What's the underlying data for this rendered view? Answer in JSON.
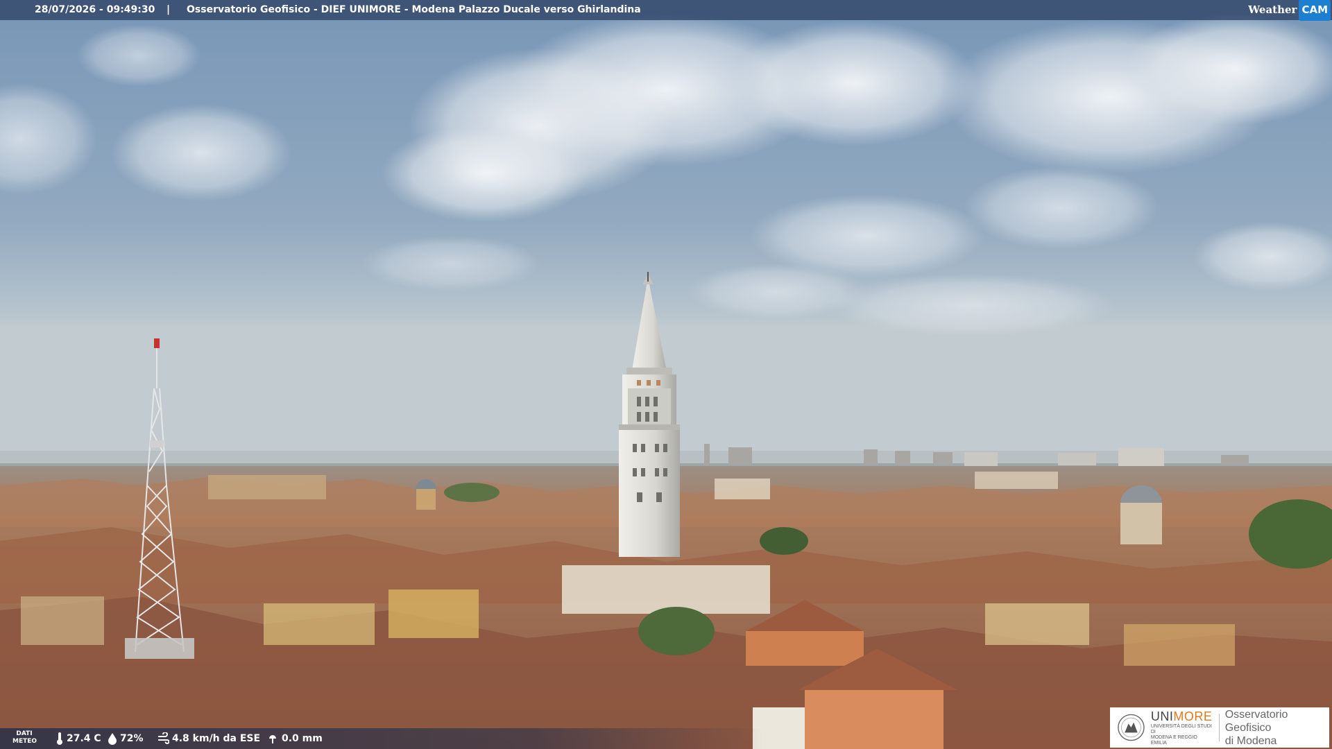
{
  "overlay": {
    "timestamp": "28/07/2026 - 09:49:30",
    "separator": "|",
    "location": "Osservatorio Geofisico - DIEF UNIMORE - Modena Palazzo Ducale verso Ghirlandina",
    "brand_weather": "Weather",
    "brand_cam": "CAM"
  },
  "weather": {
    "label_line1": "DATI",
    "label_line2": "METEO",
    "temperature": "27.4 C",
    "humidity": "72%",
    "wind": "4.8 km/h da ESE",
    "rain": "0.0 mm"
  },
  "logo": {
    "uni_prefix": "UNI",
    "uni_suffix": "MORE",
    "uni_sub1": "UNIVERSITÀ DEGLI STUDI DI",
    "uni_sub2": "MODENA E REGGIO EMILIA",
    "osservatorio_line1": "Osservatorio Geofisico",
    "osservatorio_line2": "di Modena"
  },
  "colors": {
    "sky_top": "#7f9dbd",
    "sky_horizon": "#b9c6cf",
    "roof": "#a8684a",
    "tower": "#dcdcd6",
    "brand_orange": "#e07a1a",
    "cam_blue": "#1e7fd0"
  }
}
